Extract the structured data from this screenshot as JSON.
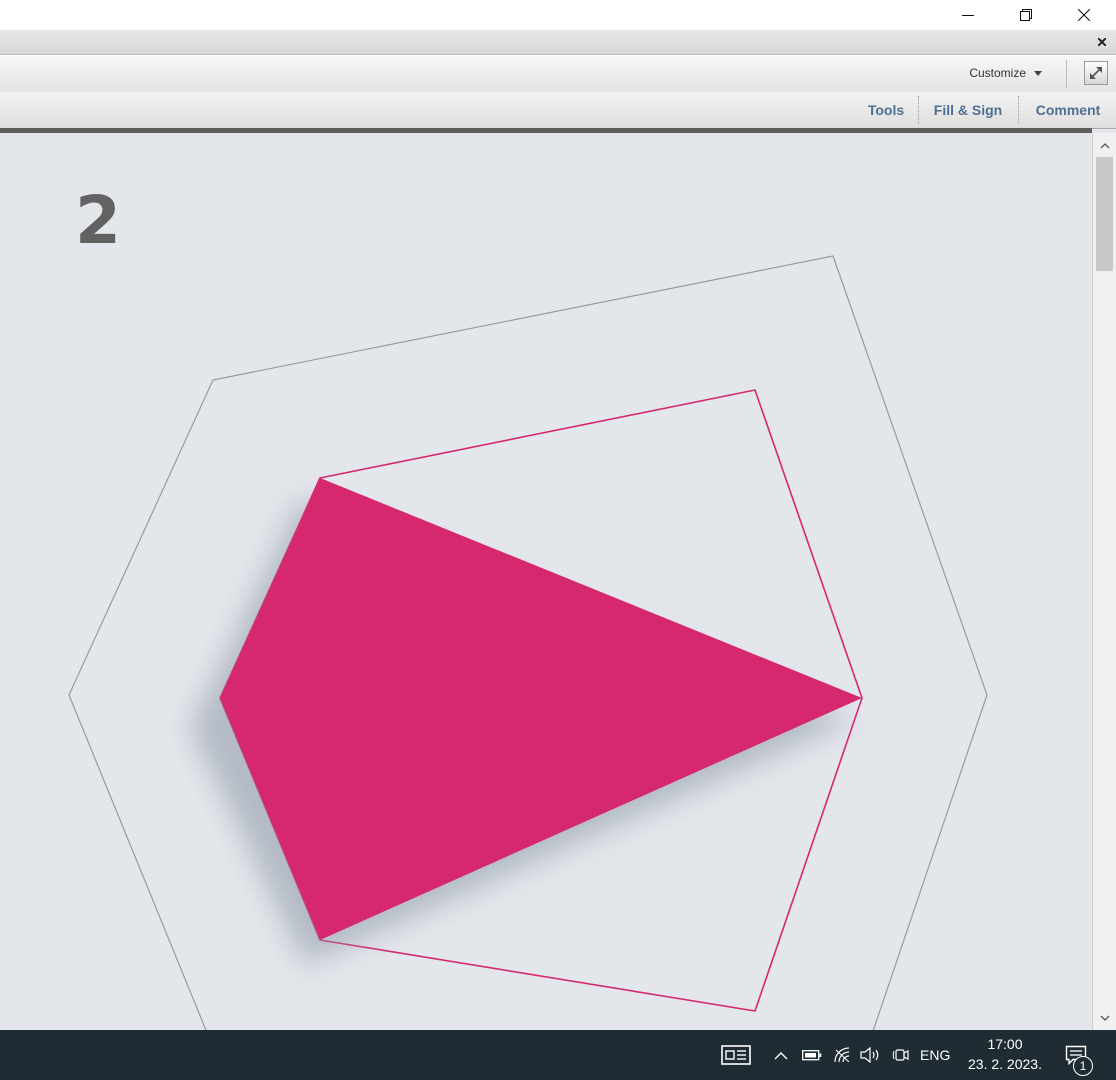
{
  "window": {
    "controls": [
      "minimize-icon",
      "restore-icon",
      "close-icon"
    ]
  },
  "toolbar": {
    "customize_label": "Customize"
  },
  "task_panes": {
    "tools": "Tools",
    "fill_sign": "Fill & Sign",
    "comment": "Comment"
  },
  "document": {
    "page_label": "2",
    "colors": {
      "background": "#e3e6eb",
      "accent_pink": "#d6286f",
      "hexagon_line": "#9a9a9a"
    }
  },
  "taskbar": {
    "language": "ENG",
    "time": "17:00",
    "date": "23. 2. 2023.",
    "notification_count": "1",
    "tray_icons": [
      "news-icon",
      "chevron-up-icon",
      "battery-icon",
      "wifi-icon",
      "volume-icon",
      "meet-now-icon",
      "notification-icon"
    ]
  }
}
